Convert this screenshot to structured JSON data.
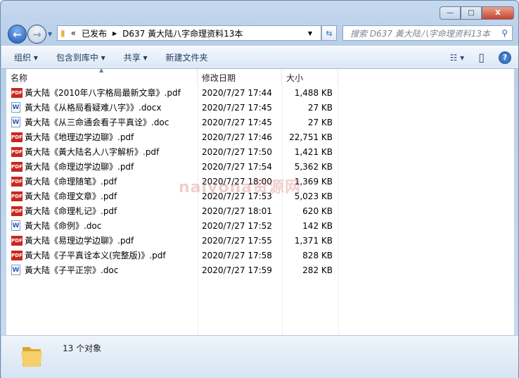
{
  "window": {
    "minimize": "—",
    "maximize": "□",
    "close": "X"
  },
  "address": {
    "overflow": "«",
    "crumbs": [
      "已发布",
      "D637 黃大陆八字命理资料13本"
    ]
  },
  "search": {
    "placeholder": "搜索 D637 黃大陆八字命理资料13本"
  },
  "toolbar": {
    "organize": "组织 ▾",
    "include_library": "包含到库中 ▾",
    "share": "共享 ▾",
    "new_folder": "新建文件夹",
    "view": "☷ ▾",
    "preview": "▯",
    "help": "?"
  },
  "columns": {
    "name": "名称",
    "date": "修改日期",
    "size": "大小"
  },
  "files": [
    {
      "type": "pdf",
      "name": "黃大陆《2010年八字格局最新文章》.pdf",
      "date": "2020/7/27 17:44",
      "size": "1,488 KB"
    },
    {
      "type": "doc",
      "name": "黃大陆《从格局看疑难八字》》.docx",
      "date": "2020/7/27 17:45",
      "size": "27 KB"
    },
    {
      "type": "doc",
      "name": "黃大陆《从三命通会看子平真诠》.doc",
      "date": "2020/7/27 17:45",
      "size": "27 KB"
    },
    {
      "type": "pdf",
      "name": "黃大陆《地理边学边聊》.pdf",
      "date": "2020/7/27 17:46",
      "size": "22,751 KB"
    },
    {
      "type": "pdf",
      "name": "黃大陆《黃大陆名人八字解析》.pdf",
      "date": "2020/7/27 17:50",
      "size": "1,421 KB"
    },
    {
      "type": "pdf",
      "name": "黃大陆《命理边学边聊》.pdf",
      "date": "2020/7/27 17:54",
      "size": "5,362 KB"
    },
    {
      "type": "pdf",
      "name": "黃大陆《命理随笔》.pdf",
      "date": "2020/7/27 18:00",
      "size": "1,369 KB"
    },
    {
      "type": "pdf",
      "name": "黃大陆《命理文章》.pdf",
      "date": "2020/7/27 17:53",
      "size": "5,023 KB"
    },
    {
      "type": "pdf",
      "name": "黃大陆《命理札记》.pdf",
      "date": "2020/7/27 18:01",
      "size": "620 KB"
    },
    {
      "type": "doc",
      "name": "黃大陆《命例》.doc",
      "date": "2020/7/27 17:52",
      "size": "142 KB"
    },
    {
      "type": "pdf",
      "name": "黃大陆《易理边学边聊》.pdf",
      "date": "2020/7/27 17:55",
      "size": "1,371 KB"
    },
    {
      "type": "pdf",
      "name": "黃大陆《子平真诠本义(完整版)》.pdf",
      "date": "2020/7/27 17:58",
      "size": "828 KB"
    },
    {
      "type": "doc",
      "name": "黃大陆《子平正宗》.doc",
      "date": "2020/7/27 17:59",
      "size": "282 KB"
    }
  ],
  "watermark": "naiyona资源网",
  "status": {
    "count": "13 个对象"
  }
}
